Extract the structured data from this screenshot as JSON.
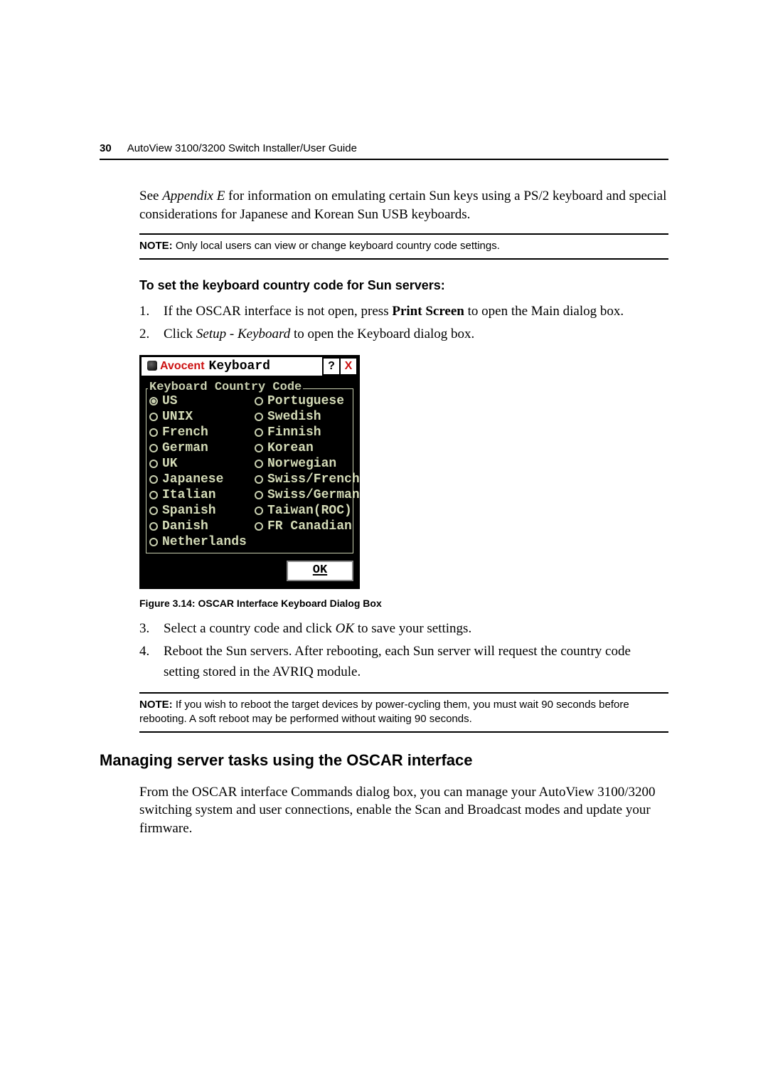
{
  "header": {
    "page_number": "30",
    "doc_title": "AutoView 3100/3200 Switch Installer/User Guide"
  },
  "intro_para": {
    "pre": "See ",
    "em": "Appendix E",
    "post": " for information on emulating certain Sun keys using a PS/2 keyboard and special considerations for Japanese and Korean Sun USB keyboards."
  },
  "note1": {
    "label": "NOTE:",
    "text": " Only local users can view or change keyboard country code settings."
  },
  "subhead1": "To set the keyboard country code for Sun servers:",
  "steps1": {
    "s1": {
      "num": "1.",
      "pre": "If the OSCAR interface is not open, press ",
      "bold": "Print Screen",
      "post": " to open the Main dialog box."
    },
    "s2": {
      "num": "2.",
      "pre": "Click ",
      "em": "Setup - Keyboard",
      "post": " to open the Keyboard dialog box."
    }
  },
  "dialog": {
    "brand": "Avocent",
    "title": "Keyboard",
    "help_label": "?",
    "close_label": "X",
    "legend": "Keyboard Country Code",
    "rows": [
      {
        "l": "US",
        "ls": true,
        "r": "Portuguese",
        "rs": false
      },
      {
        "l": "UNIX",
        "ls": false,
        "r": "Swedish",
        "rs": false
      },
      {
        "l": "French",
        "ls": false,
        "r": "Finnish",
        "rs": false
      },
      {
        "l": "German",
        "ls": false,
        "r": "Korean",
        "rs": false
      },
      {
        "l": "UK",
        "ls": false,
        "r": "Norwegian",
        "rs": false
      },
      {
        "l": "Japanese",
        "ls": false,
        "r": "Swiss/French",
        "rs": false
      },
      {
        "l": "Italian",
        "ls": false,
        "r": "Swiss/German",
        "rs": false
      },
      {
        "l": "Spanish",
        "ls": false,
        "r": "Taiwan(ROC)",
        "rs": false
      },
      {
        "l": "Danish",
        "ls": false,
        "r": "FR Canadian",
        "rs": false
      },
      {
        "l": "Netherlands",
        "ls": false,
        "r": "",
        "rs": false
      }
    ],
    "ok": "OK"
  },
  "figcap": "Figure 3.14: OSCAR Interface Keyboard Dialog Box",
  "steps2": {
    "s3": {
      "num": "3.",
      "pre": "Select a country code and click ",
      "em": "OK",
      "post": " to save your settings."
    },
    "s4": {
      "num": "4.",
      "text": "Reboot the Sun servers. After rebooting, each Sun server will request the country code setting stored in the AVRIQ module."
    }
  },
  "note2": {
    "label": "NOTE:",
    "text": " If you wish to reboot the target devices by power-cycling them, you must wait 90 seconds before rebooting. A soft reboot may be performed without waiting 90 seconds."
  },
  "h2": "Managing server tasks using the OSCAR interface",
  "closing_para": "From the OSCAR interface Commands dialog box, you can manage your AutoView 3100/3200 switching system and user connections, enable the Scan and Broadcast modes and update your firmware."
}
